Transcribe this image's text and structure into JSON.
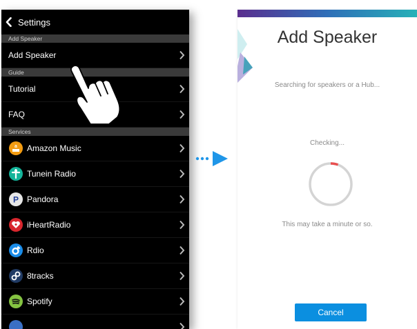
{
  "left": {
    "back_label": "Settings",
    "sections": [
      {
        "header": "Add Speaker",
        "items": [
          {
            "label": "Add Speaker"
          }
        ]
      },
      {
        "header": "Guide",
        "items": [
          {
            "label": "Tutorial"
          },
          {
            "label": "FAQ"
          }
        ]
      },
      {
        "header": "Services",
        "items": [
          {
            "label": "Amazon Music",
            "icon": "amazon-music-icon",
            "color": "#f39c12"
          },
          {
            "label": "Tunein Radio",
            "icon": "tunein-radio-icon",
            "color": "#14b49a"
          },
          {
            "label": "Pandora",
            "icon": "pandora-icon",
            "color": "#e6e6e6"
          },
          {
            "label": "iHeartRadio",
            "icon": "iheartradio-icon",
            "color": "#d8262d"
          },
          {
            "label": "Rdio",
            "icon": "rdio-icon",
            "color": "#1a8ce8"
          },
          {
            "label": "8tracks",
            "icon": "8tracks-icon",
            "color": "#203a63"
          },
          {
            "label": "Spotify",
            "icon": "spotify-icon",
            "color": "#84c341"
          }
        ]
      }
    ]
  },
  "right": {
    "title": "Add Speaker",
    "searching": "Searching for speakers or a Hub...",
    "checking": "Checking...",
    "wait_note": "This may take a minute or so.",
    "cancel_label": "Cancel",
    "accent_color": "#0b8fe0",
    "spinner_arc_color": "#e84f4f"
  }
}
